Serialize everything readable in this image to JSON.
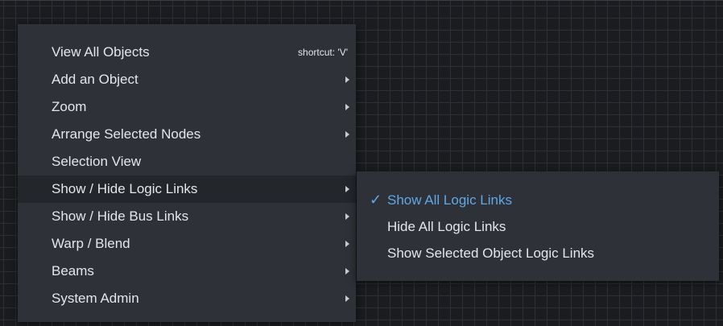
{
  "colors": {
    "background": "#1a1c1f",
    "grid": "#2c2f33",
    "menu_bg": "#2e3137",
    "active_item_bg": "#23262b",
    "text": "#e4e6ea",
    "accent": "#5fa8e8"
  },
  "context_menu": {
    "items": [
      {
        "label": "View All Objects",
        "shortcut": "shortcut: 'V'"
      },
      {
        "label": "Add an Object",
        "has_submenu": true
      },
      {
        "label": "Zoom",
        "has_submenu": true
      },
      {
        "label": "Arrange Selected Nodes",
        "has_submenu": true
      },
      {
        "label": "Selection View"
      },
      {
        "label": "Show / Hide Logic Links",
        "has_submenu": true,
        "active": true
      },
      {
        "label": "Show / Hide Bus Links",
        "has_submenu": true
      },
      {
        "label": "Warp / Blend",
        "has_submenu": true
      },
      {
        "label": "Beams",
        "has_submenu": true
      },
      {
        "label": "System Admin",
        "has_submenu": true
      }
    ]
  },
  "submenu": {
    "check_icon": "check-icon",
    "check_glyph": "✓",
    "items": [
      {
        "label": "Show All Logic Links",
        "checked": true
      },
      {
        "label": "Hide All Logic Links",
        "checked": false
      },
      {
        "label": "Show Selected Object Logic Links",
        "checked": false
      }
    ]
  }
}
